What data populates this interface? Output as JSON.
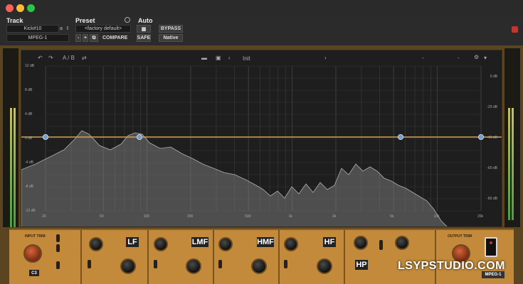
{
  "header": {
    "track_label": "Track",
    "preset_label": "Preset",
    "auto_label": "Auto",
    "track_name": "Kick#10",
    "track_suffix": "a",
    "insert_name": "MPEG-1",
    "preset_value": "<factory default>",
    "compare_label": "COMPARE",
    "bypass_label": "BYPASS",
    "safe_label": "SAFE",
    "native_label": "Native"
  },
  "toolbar": {
    "ab_label": "A / B",
    "preset_name": "Init",
    "dash1": "-",
    "dash2": "-"
  },
  "graph": {
    "left_db": [
      "12 dB",
      "8 dB",
      "4 dB",
      "0 dB",
      "-4 dB",
      "-8 dB",
      "-12 dB"
    ],
    "right_db": [
      "0 dB",
      "-20 dB",
      "-40 dB",
      "-60 dB",
      "-80 dB"
    ],
    "freq": [
      "20",
      "50",
      "100",
      "200",
      "500",
      "1k",
      "2k",
      "5k",
      "10k",
      "20k"
    ],
    "colors": {
      "eq_line": "#d4a24c",
      "node": "#7a9bd1",
      "spectrum": "#8a8a8a"
    }
  },
  "panel": {
    "input_trim_label": "INPUT TRIM",
    "output_trim_label": "OUTPUT TRIM",
    "lf_label": "LF",
    "lmf_label": "LMF",
    "hmf_label": "HMF",
    "hf_label": "HF",
    "hp_label": "HP",
    "c3_label": "C3",
    "model_label": "MPEG-1"
  },
  "watermark": "LSYPSTUDIO.COM"
}
